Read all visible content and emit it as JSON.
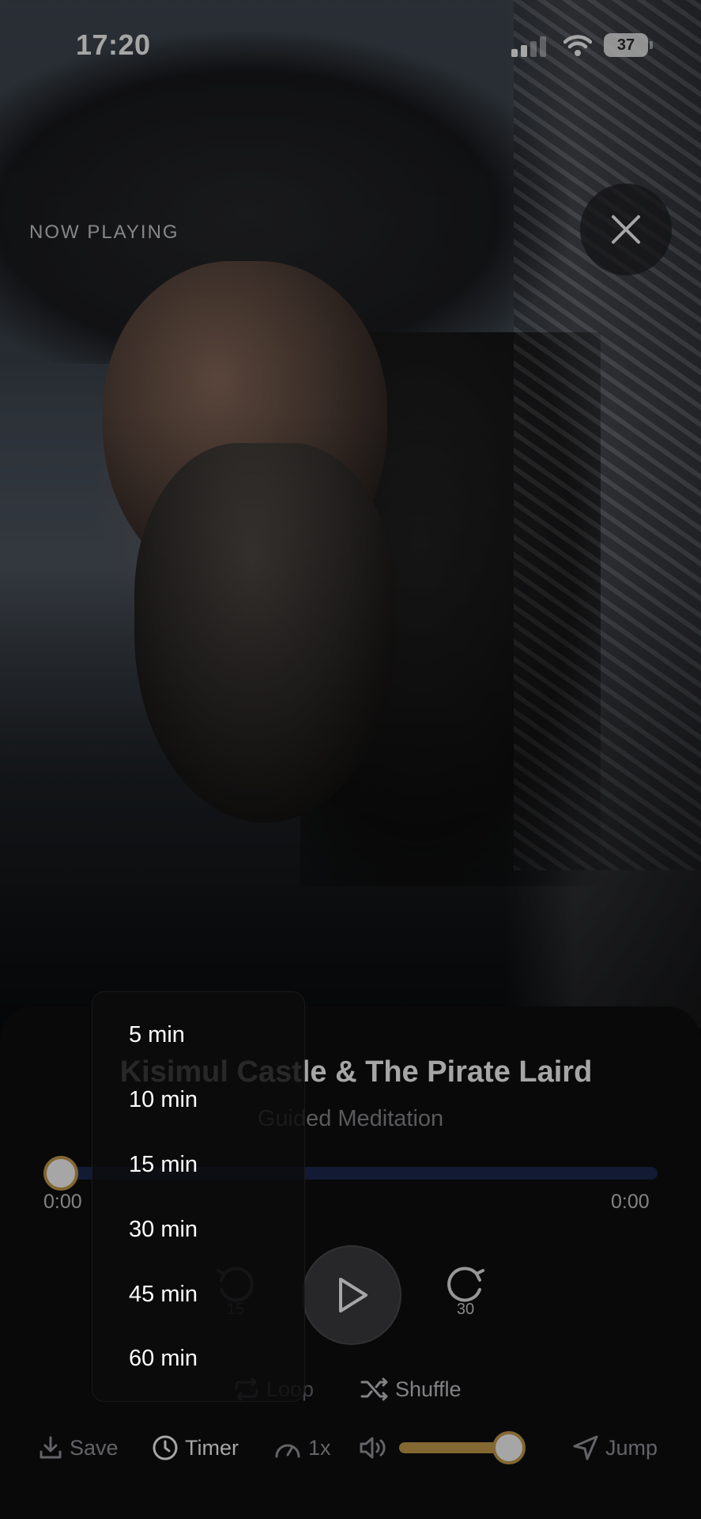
{
  "status_bar": {
    "time": "17:20",
    "battery": "37"
  },
  "header": {
    "now_playing": "NOW PLAYING"
  },
  "track": {
    "title": "Kisimul Castle & The Pirate Laird",
    "subtitle": "Guided Meditation"
  },
  "progress": {
    "elapsed": "0:00",
    "duration": "0:00",
    "fraction": 0.0
  },
  "controls": {
    "rewind_seconds": "15",
    "forward_seconds": "30",
    "loop_label": "Loop",
    "shuffle_label": "Shuffle"
  },
  "bottom_bar": {
    "save_label": "Save",
    "timer_label": "Timer",
    "speed_label": "1x",
    "jump_label": "Jump",
    "volume_fraction": 0.85
  },
  "timer_menu": {
    "options": [
      "5 min",
      "10 min",
      "15 min",
      "30 min",
      "45 min",
      "60 min"
    ]
  },
  "colors": {
    "accent_gold": "#c9a04e",
    "progress_track": "#1d2a4f",
    "sheet_bg": "#0e0e10"
  }
}
